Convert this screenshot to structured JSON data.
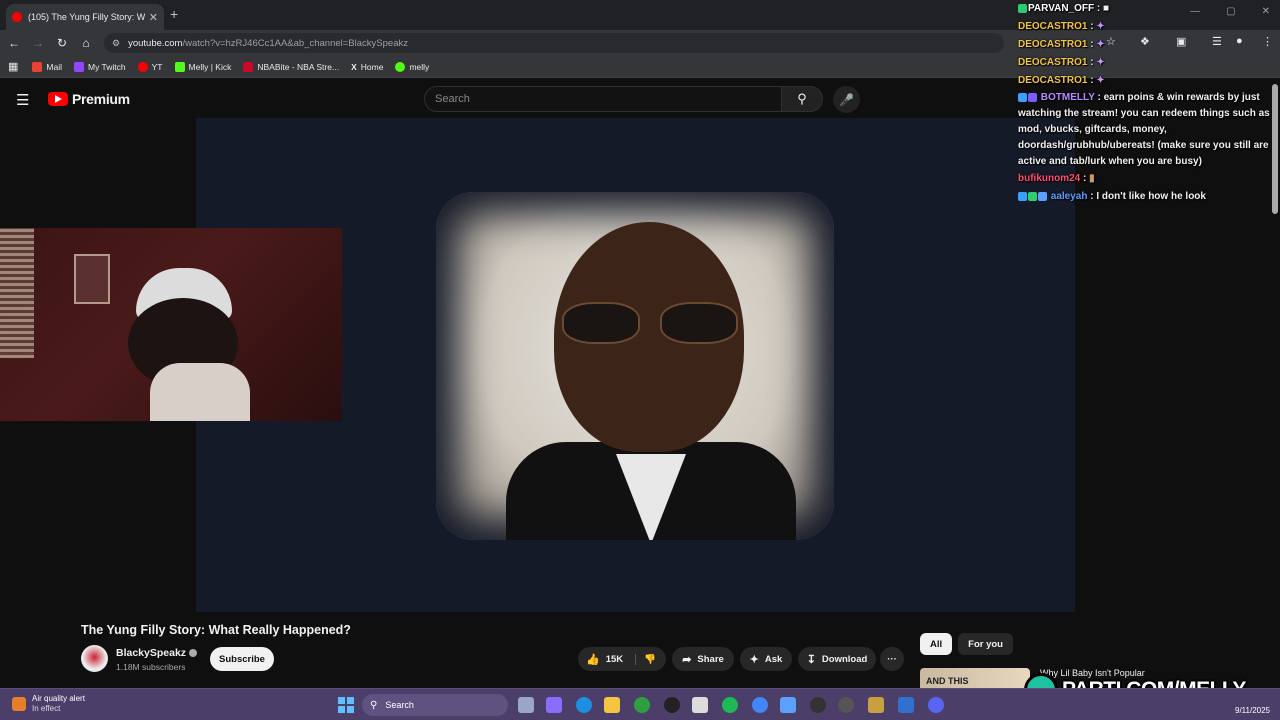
{
  "browser": {
    "tab_title": "(105) The Yung Filly Story: W",
    "tab_close": "✕",
    "new_tab": "+",
    "url_host": "youtube.com",
    "url_path": "/watch?v=hzRJ46Cc1AA&ab_channel=BlackySpeakz",
    "window_controls": [
      "—",
      "▢",
      "✕"
    ],
    "bookmarks": [
      {
        "label": "Mail",
        "color": "#ea4335"
      },
      {
        "label": "My Twitch",
        "color": "#9146ff"
      },
      {
        "label": "YT",
        "color": "#ff0000"
      },
      {
        "label": "Melly | Kick",
        "color": "#53fc18"
      },
      {
        "label": "NBABite - NBA Stre...",
        "color": "#c9082a"
      },
      {
        "label": "Home",
        "color": "#ffffff"
      },
      {
        "label": "melly",
        "color": "#53fc18"
      }
    ]
  },
  "youtube": {
    "logo_text": "Premium",
    "search_placeholder": "Search"
  },
  "chat": {
    "messages": [
      {
        "user": "PARVAN_OFF",
        "text": "",
        "color": "#ffffff"
      },
      {
        "user": "DEOCASTRO1",
        "text": "",
        "color": "#f4c542"
      },
      {
        "user": "DEOCASTRO1",
        "text": "",
        "color": "#f4c542"
      },
      {
        "user": "DEOCASTRO1",
        "text": "",
        "color": "#f4c542"
      },
      {
        "user": "DEOCASTRO1",
        "text": "",
        "color": "#f4c542"
      },
      {
        "user": "BOTMELLY",
        "text": "earn poins & win rewards by just watching the stream! you can redeem things such as mod, vbucks, giftcards, money, doordash/grubhub/ubereats! (make sure you still are active and tab/lurk when you are busy)",
        "color": "#b58cff"
      },
      {
        "user": "bufikunom24",
        "text": "",
        "color": "#ff4d6d"
      },
      {
        "user": "aaleyah",
        "text": "I don't like how he look",
        "color": "#5aa0ff"
      }
    ]
  },
  "video": {
    "title": "The Yung Filly Story: What Really Happened?",
    "channel": "BlackySpeakz",
    "subscribers": "1.18M subscribers",
    "subscribe_label": "Subscribe",
    "likes": "15K",
    "share_label": "Share",
    "ask_label": "Ask",
    "download_label": "Download",
    "more_label": "···"
  },
  "sidebar": {
    "chips": [
      "All",
      "For you"
    ],
    "thumb_text": "AND THIS",
    "rec_title": "Why Lil Baby Isn't Popular"
  },
  "overlay": {
    "brand": "PARTI.COM/MELLY"
  },
  "taskbar": {
    "alert_title": "Air quality alert",
    "alert_sub": "In effect",
    "search_label": "Search",
    "date": "9/11/2025"
  }
}
